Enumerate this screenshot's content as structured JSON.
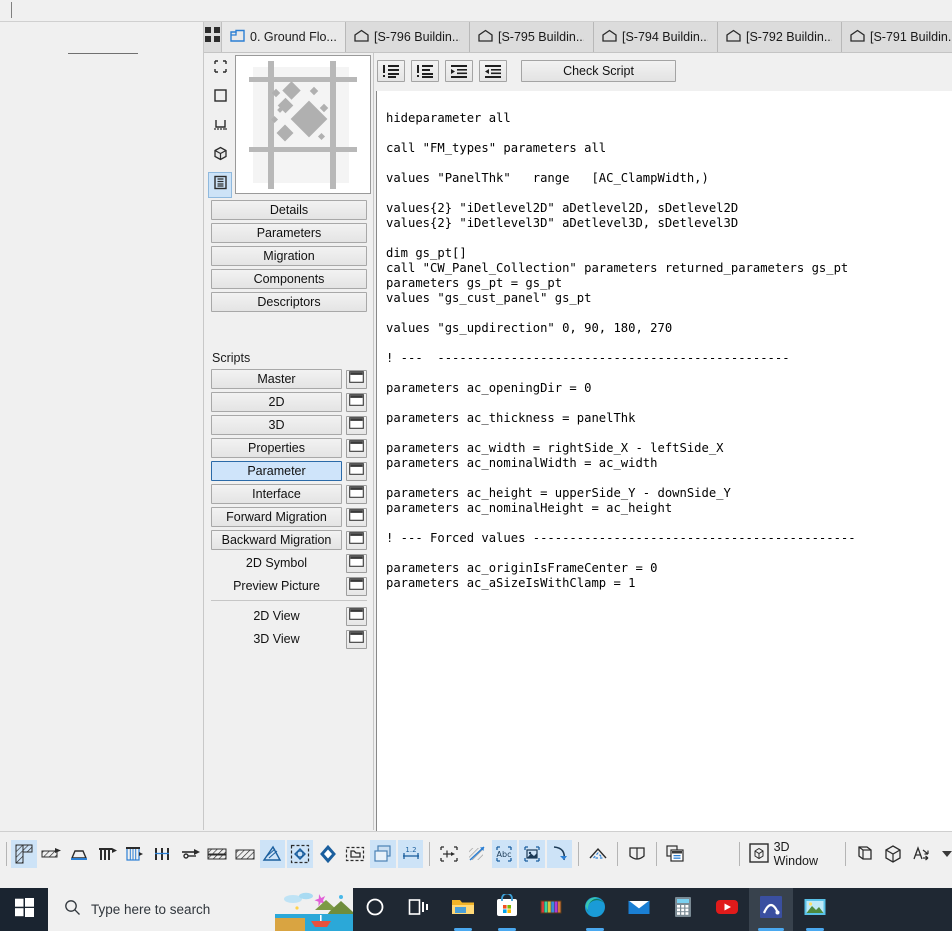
{
  "tabbar": {
    "grid_icon": "grid-view-icon",
    "tabs": [
      {
        "label": "0. Ground Flo...",
        "icon": "floorplan-icon",
        "active": true
      },
      {
        "label": "[S-796 Buildin...",
        "icon": "elevation-icon",
        "active": false
      },
      {
        "label": "[S-795 Buildin...",
        "icon": "elevation-icon",
        "active": false
      },
      {
        "label": "[S-794 Buildin...",
        "icon": "elevation-icon",
        "active": false
      },
      {
        "label": "[S-792 Buildin...",
        "icon": "elevation-icon",
        "active": false
      },
      {
        "label": "[S-791 Buildin...",
        "icon": "elevation-icon",
        "active": false
      }
    ]
  },
  "panel": {
    "icon_strip": [
      {
        "name": "selection-rect-icon",
        "selected": false
      },
      {
        "name": "square-icon",
        "selected": false
      },
      {
        "name": "symbol-icon",
        "selected": false
      },
      {
        "name": "cube-3d-icon",
        "selected": false
      },
      {
        "name": "script-list-icon",
        "selected": true
      }
    ],
    "preview_name": "object-preview-thumbnail",
    "buttons": [
      {
        "label": "Details"
      },
      {
        "label": "Parameters"
      },
      {
        "label": "Migration"
      },
      {
        "label": "Components"
      },
      {
        "label": "Descriptors"
      }
    ],
    "scripts_label": "Scripts",
    "scripts": [
      {
        "label": "Master",
        "selected": false,
        "plain": false,
        "window": true
      },
      {
        "label": "2D",
        "selected": false,
        "plain": false,
        "window": true
      },
      {
        "label": "3D",
        "selected": false,
        "plain": false,
        "window": true
      },
      {
        "label": "Properties",
        "selected": false,
        "plain": false,
        "window": true
      },
      {
        "label": "Parameter",
        "selected": true,
        "plain": false,
        "window": true
      },
      {
        "label": "Interface",
        "selected": false,
        "plain": false,
        "window": true
      },
      {
        "label": "Forward Migration",
        "selected": false,
        "plain": false,
        "window": true
      },
      {
        "label": "Backward Migration",
        "selected": false,
        "plain": false,
        "window": true
      },
      {
        "label": "2D Symbol",
        "selected": false,
        "plain": true,
        "window": true
      },
      {
        "label": "Preview Picture",
        "selected": false,
        "plain": true,
        "window": true
      }
    ],
    "views": [
      {
        "label": "2D View",
        "plain": true,
        "window": true
      },
      {
        "label": "3D View",
        "plain": true,
        "window": true
      }
    ]
  },
  "editor": {
    "toolbar": [
      {
        "name": "comment-lines-button",
        "icon": "comment-out-icon"
      },
      {
        "name": "uncomment-lines-button",
        "icon": "uncomment-icon"
      },
      {
        "name": "indent-button",
        "icon": "indent-right-icon"
      },
      {
        "name": "outdent-button",
        "icon": "indent-left-icon"
      }
    ],
    "check_script_label": "Check Script",
    "scrollbar_left_arrow": "‹",
    "code": "hideparameter all\n\ncall \"FM_types\" parameters all\n\nvalues \"PanelThk\"   range   [AC_ClampWidth,)\n\nvalues{2} \"iDetlevel2D\" aDetlevel2D, sDetlevel2D\nvalues{2} \"iDetlevel3D\" aDetlevel3D, sDetlevel3D\n\ndim gs_pt[]\ncall \"CW_Panel_Collection\" parameters returned_parameters gs_pt\nparameters gs_pt = gs_pt\nvalues \"gs_cust_panel\" gs_pt\n\nvalues \"gs_updirection\" 0, 90, 180, 270\n\n! ---  ------------------------------------------------\n\nparameters ac_openingDir = 0\n\nparameters ac_thickness = panelThk\n\nparameters ac_width = rightSide_X - leftSide_X\nparameters ac_nominalWidth = ac_width\n\nparameters ac_height = upperSide_Y - downSide_Y\nparameters ac_nominalHeight = ac_height\n\n! --- Forced values --------------------------------------------\n\nparameters ac_originIsFrameCenter = 0\nparameters ac_aSizeIsWithClamp = 1"
  },
  "app_toolbar": {
    "tools": [
      {
        "name": "wall-tool",
        "on": true
      },
      {
        "name": "beam-tool",
        "on": false
      },
      {
        "name": "slab-tool",
        "on": false
      },
      {
        "name": "column-tool",
        "on": false
      },
      {
        "name": "curtain-wall-tool",
        "on": false
      },
      {
        "name": "railing-tool",
        "on": false
      },
      {
        "name": "arrow-tool",
        "on": false
      },
      {
        "name": "roof-tool",
        "on": false
      },
      {
        "name": "shell-tool",
        "on": false
      },
      {
        "name": "morph-tool",
        "on": true
      },
      {
        "name": "mesh-tool",
        "on": true
      },
      {
        "name": "object-tool",
        "on": false
      },
      {
        "name": "lamp-tool",
        "on": false
      },
      {
        "name": "zone-tool",
        "on": true
      },
      {
        "name": "dimension-tool",
        "on": true
      },
      {
        "name": "linear-dimension-tool",
        "on": false
      },
      {
        "name": "level-dimension-tool",
        "on": false
      },
      {
        "name": "text-tool",
        "on": true
      },
      {
        "name": "figure-tool",
        "on": true
      },
      {
        "name": "arc-tool",
        "on": true
      },
      {
        "name": "section-tool",
        "on": false
      },
      {
        "name": "elevation-tool",
        "on": false
      },
      {
        "name": "worksheet-tool",
        "on": false
      }
    ],
    "window_3d_label": "3D Window",
    "view_icons": [
      {
        "name": "axonometric-view-icon"
      },
      {
        "name": "perspective-cube-icon"
      },
      {
        "name": "orientation-icon"
      }
    ],
    "caret": "dropdown-caret-icon"
  },
  "taskbar": {
    "start_icon": "windows-start-icon",
    "search_placeholder": "Type here to search",
    "search_icon": "search-icon",
    "items": [
      {
        "name": "cortana-icon",
        "active": false,
        "underline": false
      },
      {
        "name": "task-view-icon",
        "active": false,
        "underline": false
      },
      {
        "name": "file-explorer-icon",
        "active": false,
        "underline": true
      },
      {
        "name": "microsoft-store-icon",
        "active": false,
        "underline": true
      },
      {
        "name": "winrar-icon",
        "active": false,
        "underline": false
      },
      {
        "name": "microsoft-edge-icon",
        "active": false,
        "underline": true
      },
      {
        "name": "mail-icon",
        "active": false,
        "underline": false
      },
      {
        "name": "calculator-icon",
        "active": false,
        "underline": false
      },
      {
        "name": "youtube-icon",
        "active": false,
        "underline": false
      },
      {
        "name": "archicad-icon",
        "active": true,
        "underline": true
      },
      {
        "name": "photos-icon",
        "active": false,
        "underline": true
      }
    ]
  },
  "colors": {
    "selection_blue": "#cde3f7",
    "accent_blue": "#2b7fd4",
    "panel_bg": "#f0f0f0",
    "taskbar_bg": "#1f2833"
  }
}
